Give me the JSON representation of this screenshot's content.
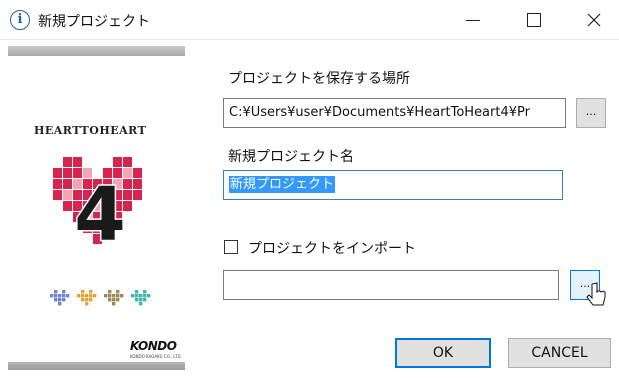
{
  "window": {
    "title": "新規プロジェクト",
    "info_icon": "i",
    "controls": [
      "minimize-icon",
      "maximize-icon",
      "close-icon"
    ]
  },
  "sidebar": {
    "brand_name": "HEARTTOHEART",
    "big_number": "4",
    "maker": "KONDO",
    "maker_sub": "KONDO KAGAKU CO., LTD.",
    "colors": {
      "heart_red": "#d8234e",
      "heart_pink": "#f0a6b6",
      "number": "#1a1a1a"
    }
  },
  "form": {
    "save_location_label": "プロジェクトを保存する場所",
    "save_location_value": "C:¥Users¥user¥Documents¥HeartToHeart4¥Pr",
    "browse_label": "...",
    "project_name_label": "新規プロジェクト名",
    "project_name_value": "新規プロジェクト",
    "import_label": "プロジェクトをインポート",
    "import_checked": false,
    "import_path_value": "",
    "import_browse_label": "..."
  },
  "buttons": {
    "ok": "OK",
    "cancel": "CANCEL"
  },
  "colors": {
    "accent": "#0078d7",
    "selection": "#3399ff"
  }
}
